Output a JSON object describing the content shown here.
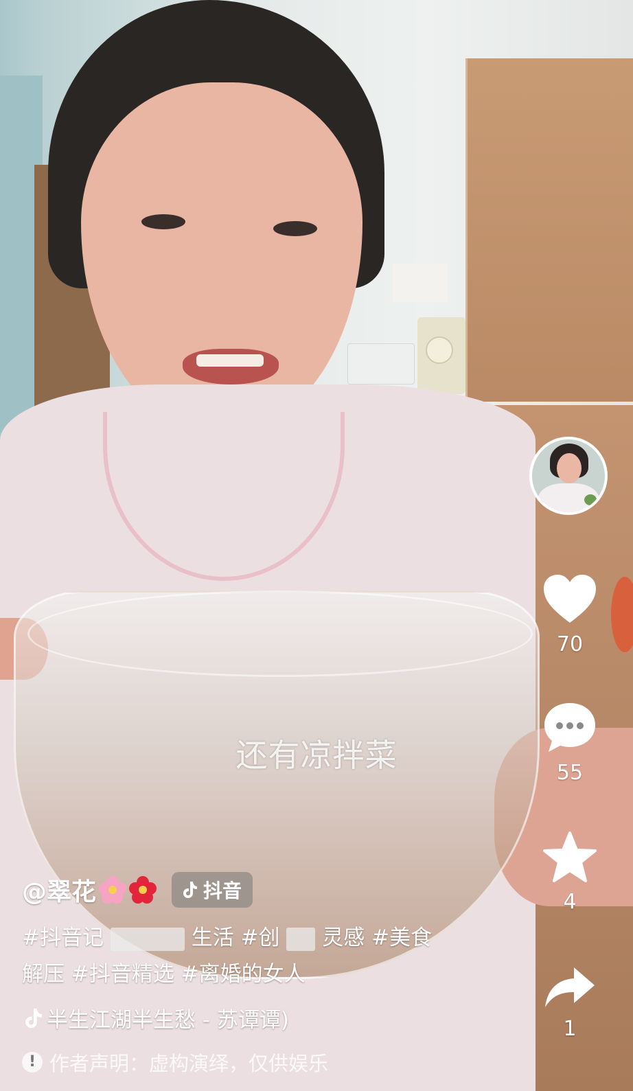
{
  "overlay": {
    "subtitle": "还有凉拌菜"
  },
  "author": {
    "handle": "@翠花",
    "emoji": [
      "cherry-blossom",
      "hibiscus"
    ],
    "platform_badge": "抖音"
  },
  "caption": {
    "tags": [
      "#抖音记",
      "生活",
      "#创",
      "灵感",
      "#美食解压",
      "#抖音精选",
      "#离婚的女人"
    ]
  },
  "music": {
    "title": "半生江湖半生愁 - 苏谭谭)"
  },
  "disclaimer": {
    "text": "作者声明：虚构演绎，仅供娱乐"
  },
  "actions": {
    "like_count": "70",
    "comment_count": "55",
    "favorite_count": "4",
    "share_count": "1"
  },
  "icons": {
    "like": "heart-icon",
    "comment": "comment-bubble-icon",
    "favorite": "star-icon",
    "share": "share-arrow-icon",
    "music": "tiktok-note-icon",
    "info": "info-icon"
  },
  "colors": {
    "overlay_text": "#ffffff",
    "badge_bg": "#787878"
  }
}
